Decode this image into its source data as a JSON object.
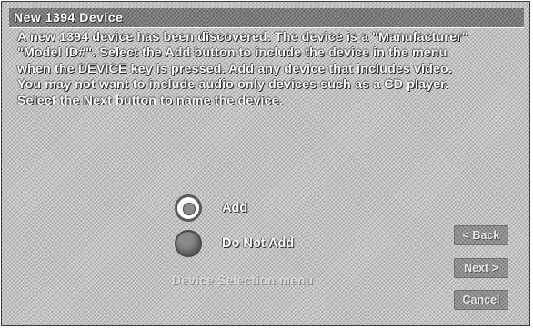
{
  "dialog": {
    "title": "New 1394 Device",
    "message": "A new 1394 device has been discovered. The device is a \"Manufacturer\"\n\"Model ID#\".  Select the Add button to include the device in the menu\nwhen the DEVICE key is pressed.  Add any device that includes video.\nYou may not want to include audio only devices such as a CD player.\nSelect the Next button to name the device."
  },
  "options": {
    "add_label": "Add",
    "do_not_add_label": "Do Not Add",
    "selected": "Add"
  },
  "section_caption": "Device Selection menu",
  "buttons": {
    "back_label": "< Back",
    "next_label": "Next >",
    "cancel_label": "Cancel"
  },
  "icons": {
    "radio_selected": "radio-selected-icon",
    "radio_unselected": "radio-unselected-icon"
  }
}
